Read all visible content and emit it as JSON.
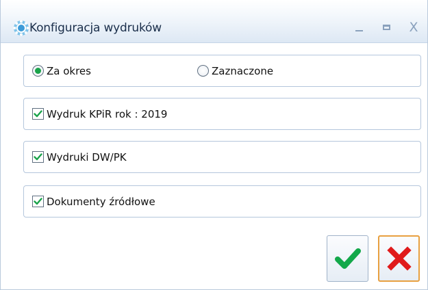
{
  "window": {
    "title": "Konfiguracja wydruków",
    "controls": {
      "minimize": "_",
      "maximize": "▭",
      "close": "X"
    }
  },
  "period_group": {
    "options": [
      {
        "label": "Za okres",
        "selected": true
      },
      {
        "label": "Zaznaczone",
        "selected": false
      }
    ]
  },
  "options": [
    {
      "label": "Wydruk KPiR rok : 2019",
      "checked": true
    },
    {
      "label": "Wydruki DW/PK",
      "checked": true
    },
    {
      "label": "Dokumenty źródłowe",
      "checked": true
    }
  ],
  "buttons": {
    "ok": "ok-check",
    "cancel": "cancel-x"
  },
  "colors": {
    "radio_dot": "#1aa34a",
    "check": "#1aa34a",
    "cancel_x": "#e01b1b",
    "cancel_border": "#e8a040",
    "group_border": "#b4c6dc"
  }
}
